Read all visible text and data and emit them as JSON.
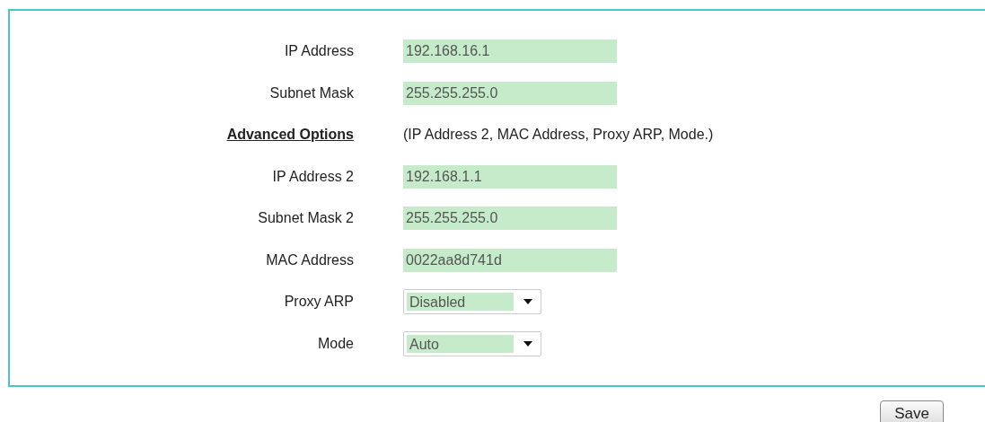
{
  "rows": [
    {
      "kind": "input",
      "label": "IP Address",
      "value": "192.168.16.1"
    },
    {
      "kind": "input",
      "label": "Subnet Mask",
      "value": "255.255.255.0"
    },
    {
      "kind": "link",
      "label": "Advanced Options",
      "note": "(IP Address 2, MAC Address, Proxy ARP, Mode.)"
    },
    {
      "kind": "input",
      "label": "IP Address 2",
      "value": "192.168.1.1"
    },
    {
      "kind": "input",
      "label": "Subnet Mask 2",
      "value": "255.255.255.0"
    },
    {
      "kind": "input",
      "label": "MAC Address",
      "value": "0022aa8d741d"
    },
    {
      "kind": "select",
      "label": "Proxy ARP",
      "value": "Disabled"
    },
    {
      "kind": "select",
      "label": "Mode",
      "value": "Auto"
    }
  ],
  "save_button": "Save"
}
